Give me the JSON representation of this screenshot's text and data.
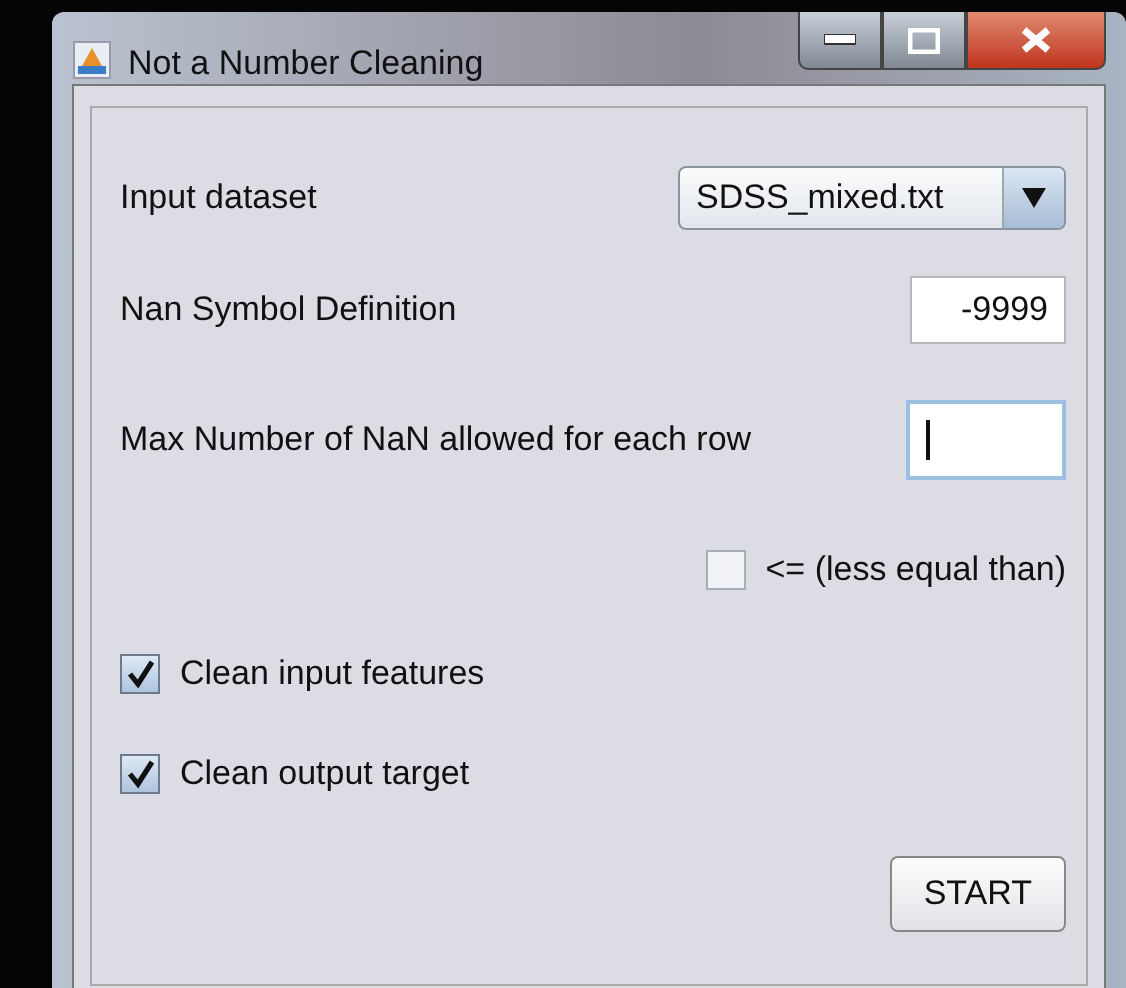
{
  "window": {
    "title": "Not a Number Cleaning",
    "controls": [
      {
        "kind": "minimize"
      },
      {
        "kind": "maximize"
      },
      {
        "kind": "close"
      }
    ]
  },
  "form": [
    {
      "kind": "combo",
      "label": "Input dataset",
      "value": "SDSS_mixed.txt"
    },
    {
      "kind": "text",
      "label": "Nan Symbol Definition",
      "value": "-9999",
      "focused": false
    },
    {
      "kind": "text",
      "label": "Max Number of NaN allowed for each row",
      "focused": true
    },
    {
      "kind": "trailing-check",
      "label": "<= (less equal than)",
      "checked": false
    },
    {
      "kind": "check",
      "label": "Clean input features",
      "checked": true
    },
    {
      "kind": "check",
      "label": "Clean output target",
      "checked": true
    }
  ],
  "buttons": [
    {
      "label": "START"
    }
  ]
}
